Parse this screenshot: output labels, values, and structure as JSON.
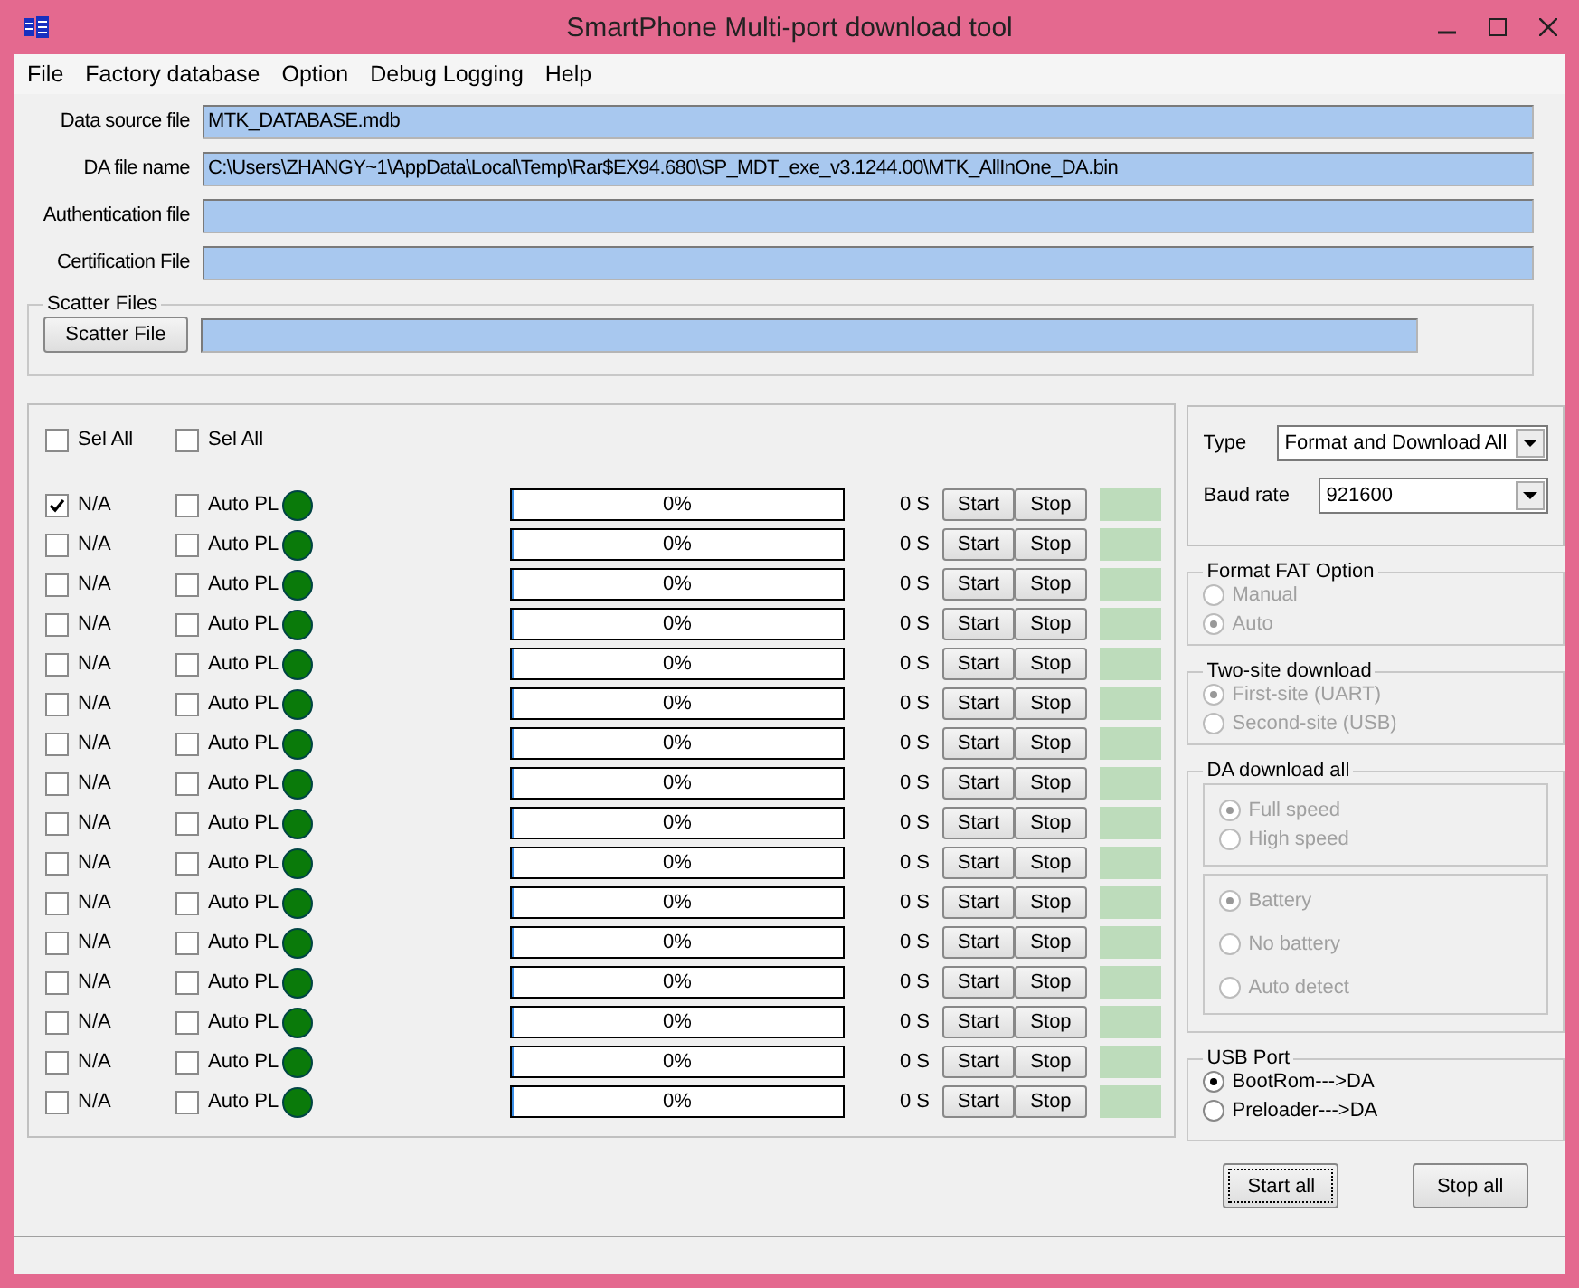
{
  "window": {
    "title": "SmartPhone Multi-port download tool"
  },
  "menu": [
    "File",
    "Factory database",
    "Option",
    "Debug Logging",
    "Help"
  ],
  "files": [
    {
      "label": "Data source file",
      "value": "MTK_DATABASE.mdb"
    },
    {
      "label": "DA file name",
      "value": "C:\\Users\\ZHANGY~1\\AppData\\Local\\Temp\\Rar$EX94.680\\SP_MDT_exe_v3.1244.00\\MTK_AllInOne_DA.bin"
    },
    {
      "label": "Authentication file"
    },
    {
      "label": "Certification File"
    }
  ],
  "scatter": {
    "title": "Scatter Files",
    "button": "Scatter File"
  },
  "sel_all": [
    {
      "label": "Sel All",
      "checked": false
    },
    {
      "label": "Sel All",
      "checked": false
    }
  ],
  "ports": [
    {
      "name": "N/A",
      "checked": true,
      "auto_label": "Auto PL",
      "auto_checked": false,
      "level": 0,
      "reading": "0%",
      "time": "0 S",
      "start": "Start",
      "stop": "Stop"
    },
    {
      "name": "N/A",
      "checked": false,
      "auto_label": "Auto PL",
      "auto_checked": false,
      "level": 0,
      "reading": "0%",
      "time": "0 S",
      "start": "Start",
      "stop": "Stop"
    },
    {
      "name": "N/A",
      "checked": false,
      "auto_label": "Auto PL",
      "auto_checked": false,
      "level": 0,
      "reading": "0%",
      "time": "0 S",
      "start": "Start",
      "stop": "Stop"
    },
    {
      "name": "N/A",
      "checked": false,
      "auto_label": "Auto PL",
      "auto_checked": false,
      "level": 0,
      "reading": "0%",
      "time": "0 S",
      "start": "Start",
      "stop": "Stop"
    },
    {
      "name": "N/A",
      "checked": false,
      "auto_label": "Auto PL",
      "auto_checked": false,
      "level": 0,
      "reading": "0%",
      "time": "0 S",
      "start": "Start",
      "stop": "Stop"
    },
    {
      "name": "N/A",
      "checked": false,
      "auto_label": "Auto PL",
      "auto_checked": false,
      "level": 0,
      "reading": "0%",
      "time": "0 S",
      "start": "Start",
      "stop": "Stop"
    },
    {
      "name": "N/A",
      "checked": false,
      "auto_label": "Auto PL",
      "auto_checked": false,
      "level": 0,
      "reading": "0%",
      "time": "0 S",
      "start": "Start",
      "stop": "Stop"
    },
    {
      "name": "N/A",
      "checked": false,
      "auto_label": "Auto PL",
      "auto_checked": false,
      "level": 0,
      "reading": "0%",
      "time": "0 S",
      "start": "Start",
      "stop": "Stop"
    },
    {
      "name": "N/A",
      "checked": false,
      "auto_label": "Auto PL",
      "auto_checked": false,
      "level": 0,
      "reading": "0%",
      "time": "0 S",
      "start": "Start",
      "stop": "Stop"
    },
    {
      "name": "N/A",
      "checked": false,
      "auto_label": "Auto PL",
      "auto_checked": false,
      "level": 0,
      "reading": "0%",
      "time": "0 S",
      "start": "Start",
      "stop": "Stop"
    },
    {
      "name": "N/A",
      "checked": false,
      "auto_label": "Auto PL",
      "auto_checked": false,
      "level": 0,
      "reading": "0%",
      "time": "0 S",
      "start": "Start",
      "stop": "Stop"
    },
    {
      "name": "N/A",
      "checked": false,
      "auto_label": "Auto PL",
      "auto_checked": false,
      "level": 0,
      "reading": "0%",
      "time": "0 S",
      "start": "Start",
      "stop": "Stop"
    },
    {
      "name": "N/A",
      "checked": false,
      "auto_label": "Auto PL",
      "auto_checked": false,
      "level": 0,
      "reading": "0%",
      "time": "0 S",
      "start": "Start",
      "stop": "Stop"
    },
    {
      "name": "N/A",
      "checked": false,
      "auto_label": "Auto PL",
      "auto_checked": false,
      "level": 0,
      "reading": "0%",
      "time": "0 S",
      "start": "Start",
      "stop": "Stop"
    },
    {
      "name": "N/A",
      "checked": false,
      "auto_label": "Auto PL",
      "auto_checked": false,
      "level": 0,
      "reading": "0%",
      "time": "0 S",
      "start": "Start",
      "stop": "Stop"
    },
    {
      "name": "N/A",
      "checked": false,
      "auto_label": "Auto PL",
      "auto_checked": false,
      "level": 0,
      "reading": "0%",
      "time": "0 S",
      "start": "Start",
      "stop": "Stop"
    }
  ],
  "settings": {
    "type_label": "Type",
    "type_value": "Format and Download All",
    "baud_label": "Baud rate",
    "baud_value": "921600"
  },
  "format_fat": {
    "title": "Format FAT Option",
    "options": [
      {
        "label": "Manual",
        "selected": false,
        "disabled": true
      },
      {
        "label": "Auto",
        "selected": true,
        "disabled": true
      }
    ]
  },
  "two_site": {
    "title": "Two-site download",
    "options": [
      {
        "label": "First-site (UART)",
        "selected": true,
        "disabled": true
      },
      {
        "label": "Second-site (USB)",
        "selected": false,
        "disabled": true
      }
    ]
  },
  "da_download": {
    "title": "DA download all",
    "speed": [
      {
        "label": "Full speed",
        "selected": true,
        "disabled": true
      },
      {
        "label": "High speed",
        "selected": false,
        "disabled": true
      }
    ],
    "battery": [
      {
        "label": "Battery",
        "selected": true,
        "disabled": true
      },
      {
        "label": "No battery",
        "selected": false,
        "disabled": true
      },
      {
        "label": "Auto detect",
        "selected": false,
        "disabled": true
      }
    ]
  },
  "usb_port": {
    "title": "USB Port",
    "options": [
      {
        "label": "BootRom--->DA",
        "selected": true,
        "disabled": false
      },
      {
        "label": "Preloader--->DA",
        "selected": false,
        "disabled": false
      }
    ]
  },
  "actions": [
    {
      "label": "Start all",
      "focused": true
    },
    {
      "label": "Stop all",
      "focused": false
    }
  ]
}
